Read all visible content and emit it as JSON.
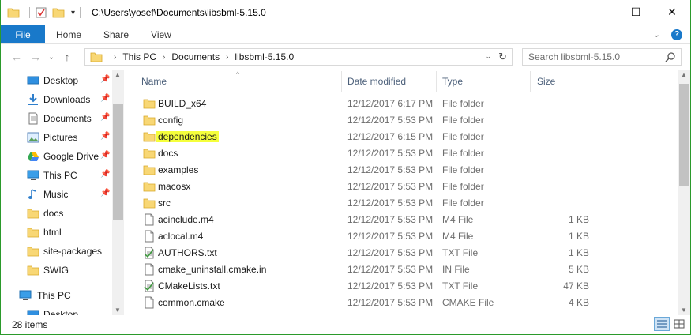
{
  "titlebar": {
    "title": "C:\\Users\\yosef\\Documents\\libsbml-5.15.0",
    "minimize": "—",
    "maximize": "☐",
    "close": "✕"
  },
  "ribbon": {
    "tabs": [
      "File",
      "Home",
      "Share",
      "View"
    ],
    "expand": "⌄",
    "help": "?"
  },
  "nav": {
    "back": "←",
    "forward": "→",
    "recent": "⌄",
    "up": "↑"
  },
  "address": {
    "crumbs": [
      "This PC",
      "Documents",
      "libsbml-5.15.0"
    ],
    "dropdown": "⌄",
    "refresh": "↻"
  },
  "search": {
    "placeholder": "Search libsbml-5.15.0"
  },
  "navpane": {
    "items": [
      {
        "label": "Desktop",
        "icon": "desktop-icon",
        "pinned": true
      },
      {
        "label": "Downloads",
        "icon": "download-icon",
        "pinned": true
      },
      {
        "label": "Documents",
        "icon": "documents-icon",
        "pinned": true
      },
      {
        "label": "Pictures",
        "icon": "pictures-icon",
        "pinned": true
      },
      {
        "label": "Google Drive",
        "icon": "google-drive-icon",
        "pinned": true
      },
      {
        "label": "This PC",
        "icon": "computer-icon",
        "pinned": true
      },
      {
        "label": "Music",
        "icon": "music-icon",
        "pinned": true
      },
      {
        "label": "docs",
        "icon": "folder-icon",
        "pinned": false
      },
      {
        "label": "html",
        "icon": "folder-icon",
        "pinned": false
      },
      {
        "label": "site-packages",
        "icon": "folder-icon",
        "pinned": false
      },
      {
        "label": "SWIG",
        "icon": "folder-icon",
        "pinned": false
      }
    ],
    "this_pc": "This PC",
    "desktop": "Desktop"
  },
  "columns": {
    "name": "Name",
    "date": "Date modified",
    "type": "Type",
    "size": "Size"
  },
  "files": [
    {
      "name": "BUILD_x64",
      "date": "12/12/2017 6:17 PM",
      "type": "File folder",
      "size": "",
      "icon": "folder-icon"
    },
    {
      "name": "config",
      "date": "12/12/2017 5:53 PM",
      "type": "File folder",
      "size": "",
      "icon": "folder-icon"
    },
    {
      "name": "dependencies",
      "date": "12/12/2017 6:15 PM",
      "type": "File folder",
      "size": "",
      "icon": "folder-icon",
      "highlight": true
    },
    {
      "name": "docs",
      "date": "12/12/2017 5:53 PM",
      "type": "File folder",
      "size": "",
      "icon": "folder-icon"
    },
    {
      "name": "examples",
      "date": "12/12/2017 5:53 PM",
      "type": "File folder",
      "size": "",
      "icon": "folder-icon"
    },
    {
      "name": "macosx",
      "date": "12/12/2017 5:53 PM",
      "type": "File folder",
      "size": "",
      "icon": "folder-icon"
    },
    {
      "name": "src",
      "date": "12/12/2017 5:53 PM",
      "type": "File folder",
      "size": "",
      "icon": "folder-icon"
    },
    {
      "name": "acinclude.m4",
      "date": "12/12/2017 5:53 PM",
      "type": "M4 File",
      "size": "1 KB",
      "icon": "file-icon"
    },
    {
      "name": "aclocal.m4",
      "date": "12/12/2017 5:53 PM",
      "type": "M4 File",
      "size": "1 KB",
      "icon": "file-icon"
    },
    {
      "name": "AUTHORS.txt",
      "date": "12/12/2017 5:53 PM",
      "type": "TXT File",
      "size": "1 KB",
      "icon": "text-file-icon"
    },
    {
      "name": "cmake_uninstall.cmake.in",
      "date": "12/12/2017 5:53 PM",
      "type": "IN File",
      "size": "5 KB",
      "icon": "file-icon"
    },
    {
      "name": "CMakeLists.txt",
      "date": "12/12/2017 5:53 PM",
      "type": "TXT File",
      "size": "47 KB",
      "icon": "text-file-icon"
    },
    {
      "name": "common.cmake",
      "date": "12/12/2017 5:53 PM",
      "type": "CMAKE File",
      "size": "4 KB",
      "icon": "file-icon"
    }
  ],
  "status": {
    "count": "28 items"
  },
  "colors": {
    "accent": "#1979ca",
    "highlight": "#f5ff3c",
    "folder": "#f8d775",
    "window_border": "#2b9a2b"
  }
}
